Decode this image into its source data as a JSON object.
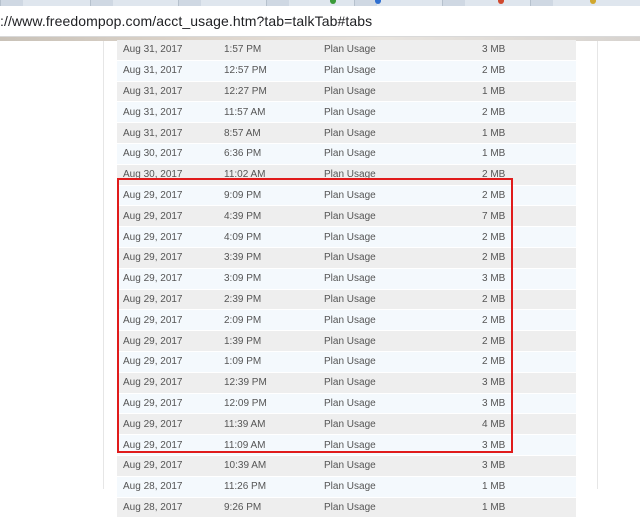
{
  "browser": {
    "url": "://www.freedompop.com/acct_usage.htm?tab=talkTab#tabs"
  },
  "usage_table": {
    "rows": [
      {
        "date": "Aug 31, 2017",
        "time": "1:57 PM",
        "type": "Plan Usage",
        "size": "3 MB"
      },
      {
        "date": "Aug 31, 2017",
        "time": "12:57 PM",
        "type": "Plan Usage",
        "size": "2 MB"
      },
      {
        "date": "Aug 31, 2017",
        "time": "12:27 PM",
        "type": "Plan Usage",
        "size": "1 MB"
      },
      {
        "date": "Aug 31, 2017",
        "time": "11:57 AM",
        "type": "Plan Usage",
        "size": "2 MB"
      },
      {
        "date": "Aug 31, 2017",
        "time": "8:57 AM",
        "type": "Plan Usage",
        "size": "1 MB"
      },
      {
        "date": "Aug 30, 2017",
        "time": "6:36 PM",
        "type": "Plan Usage",
        "size": "1 MB"
      },
      {
        "date": "Aug 30, 2017",
        "time": "11:02 AM",
        "type": "Plan Usage",
        "size": "2 MB"
      },
      {
        "date": "Aug 29, 2017",
        "time": "9:09 PM",
        "type": "Plan Usage",
        "size": "2 MB"
      },
      {
        "date": "Aug 29, 2017",
        "time": "4:39 PM",
        "type": "Plan Usage",
        "size": "7 MB"
      },
      {
        "date": "Aug 29, 2017",
        "time": "4:09 PM",
        "type": "Plan Usage",
        "size": "2 MB"
      },
      {
        "date": "Aug 29, 2017",
        "time": "3:39 PM",
        "type": "Plan Usage",
        "size": "2 MB"
      },
      {
        "date": "Aug 29, 2017",
        "time": "3:09 PM",
        "type": "Plan Usage",
        "size": "3 MB"
      },
      {
        "date": "Aug 29, 2017",
        "time": "2:39 PM",
        "type": "Plan Usage",
        "size": "2 MB"
      },
      {
        "date": "Aug 29, 2017",
        "time": "2:09 PM",
        "type": "Plan Usage",
        "size": "2 MB"
      },
      {
        "date": "Aug 29, 2017",
        "time": "1:39 PM",
        "type": "Plan Usage",
        "size": "2 MB"
      },
      {
        "date": "Aug 29, 2017",
        "time": "1:09 PM",
        "type": "Plan Usage",
        "size": "2 MB"
      },
      {
        "date": "Aug 29, 2017",
        "time": "12:39 PM",
        "type": "Plan Usage",
        "size": "3 MB"
      },
      {
        "date": "Aug 29, 2017",
        "time": "12:09 PM",
        "type": "Plan Usage",
        "size": "3 MB"
      },
      {
        "date": "Aug 29, 2017",
        "time": "11:39 AM",
        "type": "Plan Usage",
        "size": "4 MB"
      },
      {
        "date": "Aug 29, 2017",
        "time": "11:09 AM",
        "type": "Plan Usage",
        "size": "3 MB"
      },
      {
        "date": "Aug 29, 2017",
        "time": "10:39 AM",
        "type": "Plan Usage",
        "size": "3 MB"
      },
      {
        "date": "Aug 28, 2017",
        "time": "11:26 PM",
        "type": "Plan Usage",
        "size": "1 MB"
      },
      {
        "date": "Aug 28, 2017",
        "time": "9:26 PM",
        "type": "Plan Usage",
        "size": "1 MB"
      }
    ]
  },
  "colors": {
    "highlight_border": "#e01b1b",
    "row_odd": "#eeeeee",
    "row_even": "#f4f9fd",
    "text": "#555555"
  }
}
